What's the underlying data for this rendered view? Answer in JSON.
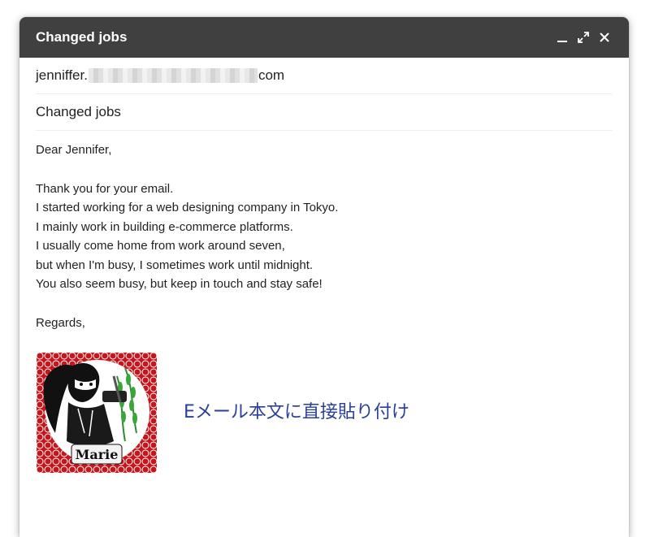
{
  "window": {
    "title": "Changed jobs"
  },
  "compose": {
    "to_prefix": "jenniffer.",
    "to_suffix": "com",
    "subject": "Changed jobs"
  },
  "message": {
    "greeting": "Dear Jennifer,",
    "lines": [
      "Thank you for your email.",
      "I started working for a web designing company in Tokyo.",
      "I mainly work in building e-commerce platforms.",
      "I usually come home from work around seven,",
      "but when I'm busy, I sometimes work until midnight.",
      "You also seem busy, but keep in touch and stay safe!"
    ],
    "closing": "Regards,"
  },
  "signature": {
    "name": "Marie",
    "caption": "Eメール本文に直接貼り付け",
    "frame_color": "#c4161c",
    "accent_color": "#2a3f9a"
  },
  "icons": [
    "minimize-icon",
    "expand-icon",
    "close-icon"
  ]
}
